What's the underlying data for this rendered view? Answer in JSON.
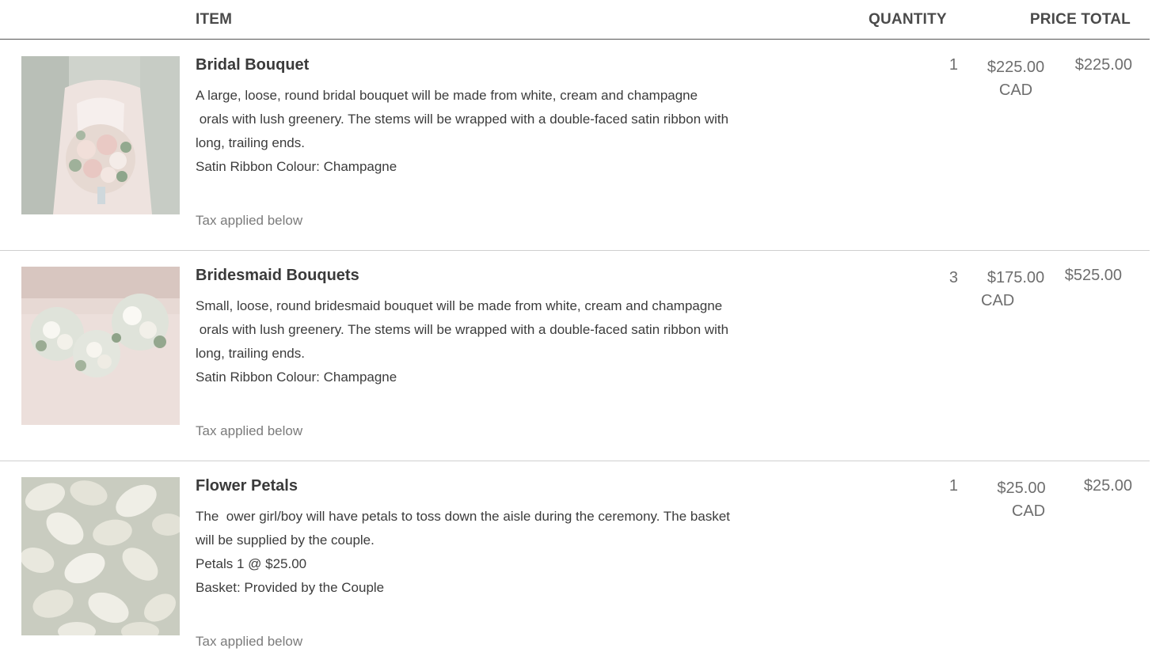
{
  "header": {
    "item": "ITEM",
    "quantity": "QUANTITY",
    "price_total": "PRICE TOTAL"
  },
  "items": [
    {
      "name": "Bridal Bouquet",
      "description": [
        "A large, loose, round bridal bouquet will be made from white, cream and champagne",
        " orals with lush greenery. The stems will be wrapped with a double-faced satin ribbon with",
        "long, trailing ends.",
        "Satin Ribbon Colour: Champagne"
      ],
      "tax_note": "Tax applied below",
      "quantity": "1",
      "price": "$225.00",
      "currency": "CAD",
      "total": "$225.00",
      "image": "bride-holding-bouquet-photo"
    },
    {
      "name": "Bridesmaid Bouquets",
      "description": [
        "Small, loose, round bridesmaid bouquet will be made from white, cream and champagne",
        " orals with lush greenery. The stems will be wrapped with a double-faced satin ribbon with",
        "long, trailing ends.",
        "Satin Ribbon Colour: Champagne"
      ],
      "tax_note": "Tax applied below",
      "quantity": "3",
      "price": "$175.00",
      "currency": "CAD",
      "total": "$525.00",
      "image": "bridesmaids-bouquets-photo"
    },
    {
      "name": "Flower Petals",
      "description": [
        "The  ower girl/boy will have petals to toss down the aisle during the ceremony. The basket",
        "will be supplied by the couple.",
        "Petals 1 @ $25.00",
        "Basket: Provided by the Couple"
      ],
      "tax_note": "Tax applied below",
      "quantity": "1",
      "price": "$25.00",
      "currency": "CAD",
      "total": "$25.00",
      "image": "white-rose-petals-photo"
    }
  ],
  "colors": {
    "header_rule": "#555555",
    "row_divider": "#cfcfcf",
    "muted_text": "#7b7b7b"
  }
}
